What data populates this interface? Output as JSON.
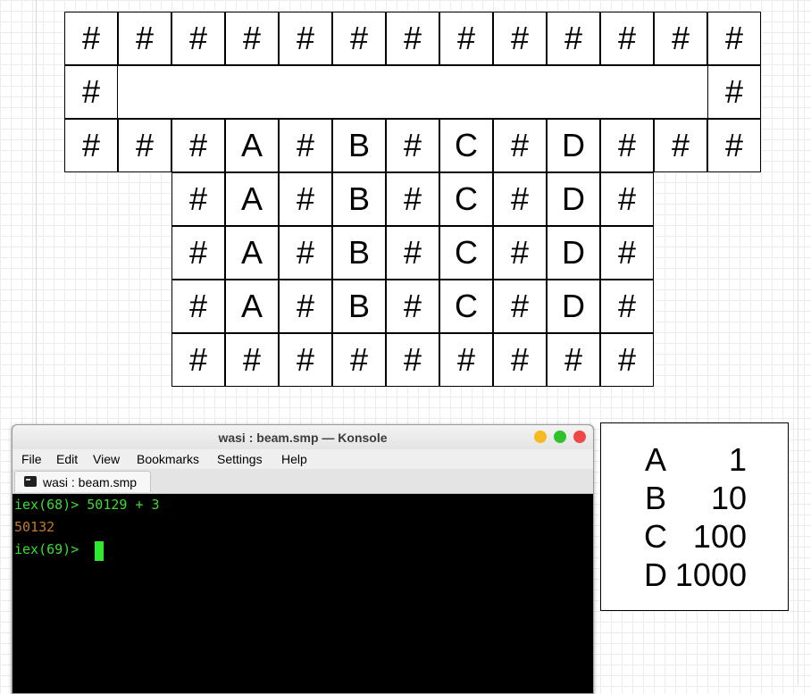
{
  "grid": {
    "rows": [
      [
        "#",
        "#",
        "#",
        "#",
        "#",
        "#",
        "#",
        "#",
        "#",
        "#",
        "#",
        "#",
        "#"
      ],
      [
        "#",
        "",
        "",
        "",
        "",
        "",
        "",
        "",
        "",
        "",
        "",
        "",
        "#"
      ],
      [
        "#",
        "#",
        "#",
        "A",
        "#",
        "B",
        "#",
        "C",
        "#",
        "D",
        "#",
        "#",
        "#"
      ],
      [
        "",
        "",
        "#",
        "A",
        "#",
        "B",
        "#",
        "C",
        "#",
        "D",
        "#",
        "",
        ""
      ],
      [
        "",
        "",
        "#",
        "A",
        "#",
        "B",
        "#",
        "C",
        "#",
        "D",
        "#",
        "",
        ""
      ],
      [
        "",
        "",
        "#",
        "A",
        "#",
        "B",
        "#",
        "C",
        "#",
        "D",
        "#",
        "",
        ""
      ],
      [
        "",
        "",
        "#",
        "#",
        "#",
        "#",
        "#",
        "#",
        "#",
        "#",
        "#",
        "",
        ""
      ]
    ]
  },
  "legend": {
    "items": [
      {
        "key": "A",
        "value": "1"
      },
      {
        "key": "B",
        "value": "10"
      },
      {
        "key": "C",
        "value": "100"
      },
      {
        "key": "D",
        "value": "1000"
      }
    ]
  },
  "konsole": {
    "title": "wasi : beam.smp — Konsole",
    "window_buttons": {
      "minimize": "#f5b921",
      "maximize": "#2fc22d",
      "close": "#ef4646"
    },
    "menu": [
      "File",
      "Edit",
      "View",
      "Bookmarks",
      "Settings",
      "Help"
    ],
    "tab_label": "wasi : beam.smp",
    "lines": [
      {
        "type": "prompt",
        "text": "iex(68)> 50129 + 3"
      },
      {
        "type": "output",
        "text": "50132"
      },
      {
        "type": "prompt",
        "text": "iex(69)> "
      }
    ],
    "colors": {
      "prompt": "#3ddc34",
      "output": "#c27a2a",
      "cursor": "#2fe82f"
    }
  }
}
